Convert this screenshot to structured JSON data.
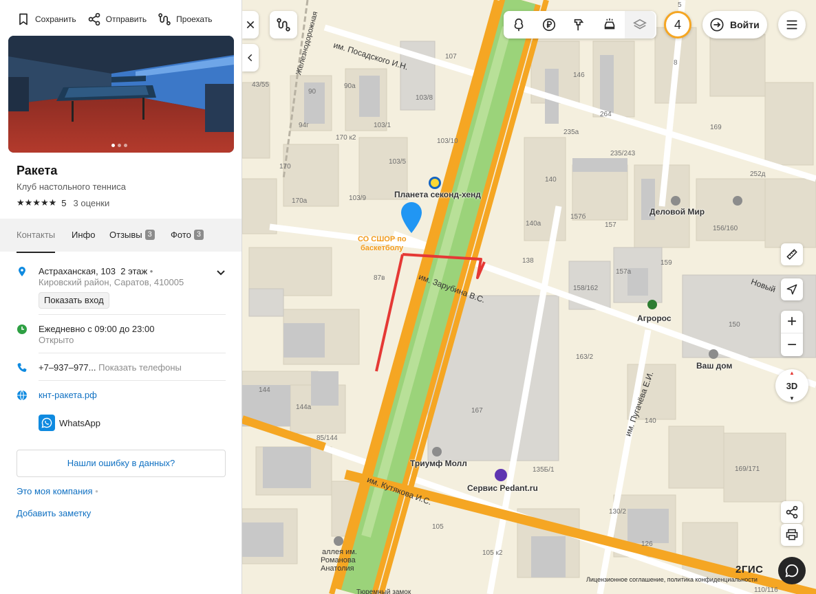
{
  "actions": {
    "save": "Сохранить",
    "share": "Отправить",
    "route": "Проехать"
  },
  "place": {
    "name": "Ракета",
    "category": "Клуб настольного тенниса",
    "stars": "★★★★★",
    "rating": "5",
    "reviews_count": "3 оценки"
  },
  "photos": {
    "count": 3,
    "active": 0
  },
  "tabs": [
    {
      "label": "Контакты",
      "badge": ""
    },
    {
      "label": "Инфо",
      "badge": ""
    },
    {
      "label": "Отзывы",
      "badge": "3"
    },
    {
      "label": "Фото",
      "badge": "3"
    }
  ],
  "contacts": {
    "address": "Астраханская, 103",
    "floor": "2 этаж",
    "district": "Кировский район, Саратов, 410005",
    "show_entrance": "Показать вход",
    "hours": "Ежедневно с 09:00 до 23:00",
    "status": "Открыто",
    "phone": "+7‒937‒977...",
    "show_phones": "Показать телефоны",
    "website": "кнт-ракета.рф",
    "whatsapp": "WhatsApp",
    "report_error": "Нашли ошибку в данных?",
    "my_company": "Это моя компания",
    "add_note": "Добавить заметку"
  },
  "map": {
    "counter": "4",
    "login": "Войти",
    "zoom_in": "+",
    "zoom_out": "−",
    "btn_3d": "3D",
    "compass_n": "▲",
    "compass_s": "▼",
    "brand": "2ГИС",
    "legal": "Лицензионное соглашение, политика конфиденциальности",
    "streets": {
      "posadsky": "им. Посадского И.Н.",
      "zheleznodorozhnaya": "Железнодорожная",
      "zarubina": "им. Зарубина В.С.",
      "kutyakova": "им. Кутякова И.С.",
      "pugacheva": "им. Пугачёва Е.И.",
      "novy": "Новый"
    },
    "pois": {
      "planeta": "Планета секонд-хенд",
      "sshor_1": "СО СШОР по",
      "sshor_2": "баскетболу",
      "delovoy": "Деловой Мир",
      "agroros": "Агророс",
      "vash_dom": "Ваш дом",
      "triumf": "Триумф Молл",
      "pedant": "Сервис Pedant.ru",
      "alley_1": "аллея им.",
      "alley_2": "Романова",
      "alley_3": "Анатолия",
      "prison": "Тюремный замок"
    },
    "houses": {
      "h107": "107",
      "h5": "5",
      "h8": "8",
      "h90": "90",
      "h90a": "90а",
      "h103_8": "103/8",
      "h146": "146",
      "h43_55": "43/55",
      "h94g": "94г",
      "h103_1": "103/1",
      "h264": "264",
      "h169": "169",
      "h170k2": "170 к2",
      "h103_10": "103/10",
      "h235a": "235а",
      "h235_243": "235/243",
      "h170": "170",
      "h103_5": "103/5",
      "h140": "140",
      "h252d": "252д",
      "h170a": "170а",
      "h103_9": "103/9",
      "h157b": "157б",
      "h157": "157",
      "h156_160": "156/160",
      "h140a": "140а",
      "h138": "138",
      "h159": "159",
      "h157a": "157а",
      "h87v": "87в",
      "h158_162": "158/162",
      "h150": "150",
      "h163_2": "163/2",
      "h144": "144",
      "h144a": "144а",
      "h167": "167",
      "h140b": "140",
      "h85_144": "85/144",
      "h169_171": "169/171",
      "h135_1": "135Б/1",
      "h130_2": "130/2",
      "h105": "105",
      "h126": "126",
      "h105k2": "105 к2",
      "h110_116": "110/116"
    }
  }
}
